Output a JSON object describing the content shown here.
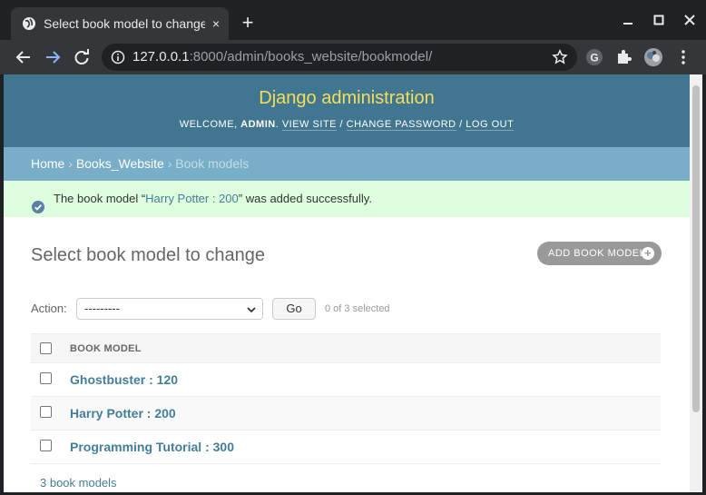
{
  "browser": {
    "tab_title": "Select book model to change",
    "tab_close": "×",
    "new_tab": "+",
    "url_host": "127.0.0.1",
    "url_rest": ":8000/admin/books_website/bookmodel/",
    "extension_g": "G"
  },
  "header": {
    "site_name": "Django administration",
    "welcome": "Welcome, ",
    "username": "admin",
    "period": ". ",
    "view_site": "View site",
    "sep1": " / ",
    "change_password": "Change password",
    "sep2": " / ",
    "log_out": "Log out"
  },
  "breadcrumbs": {
    "home": "Home",
    "sep": " › ",
    "app": "Books_Website",
    "current": "Book models"
  },
  "message": {
    "prefix": "The book model “",
    "object": "Harry Potter : 200",
    "suffix": "” was added successfully."
  },
  "page": {
    "title": "Select book model to change",
    "add_button": "Add book model",
    "add_plus": "+"
  },
  "actions": {
    "label": "Action:",
    "selected_option": "---------",
    "go_button": "Go",
    "counter": "0 of 3 selected"
  },
  "table": {
    "column_header": "Book model",
    "rows": [
      {
        "label": "Ghostbuster : 120"
      },
      {
        "label": "Harry Potter : 200"
      },
      {
        "label": "Programming Tutorial : 300"
      }
    ]
  },
  "paginator": {
    "count": "3 book models"
  },
  "colors": {
    "header_bg": "#417690",
    "breadcrumbs_bg": "#79aec8",
    "message_bg": "#ddffdd",
    "link": "#447e9b",
    "branding": "#f5dd5d"
  }
}
